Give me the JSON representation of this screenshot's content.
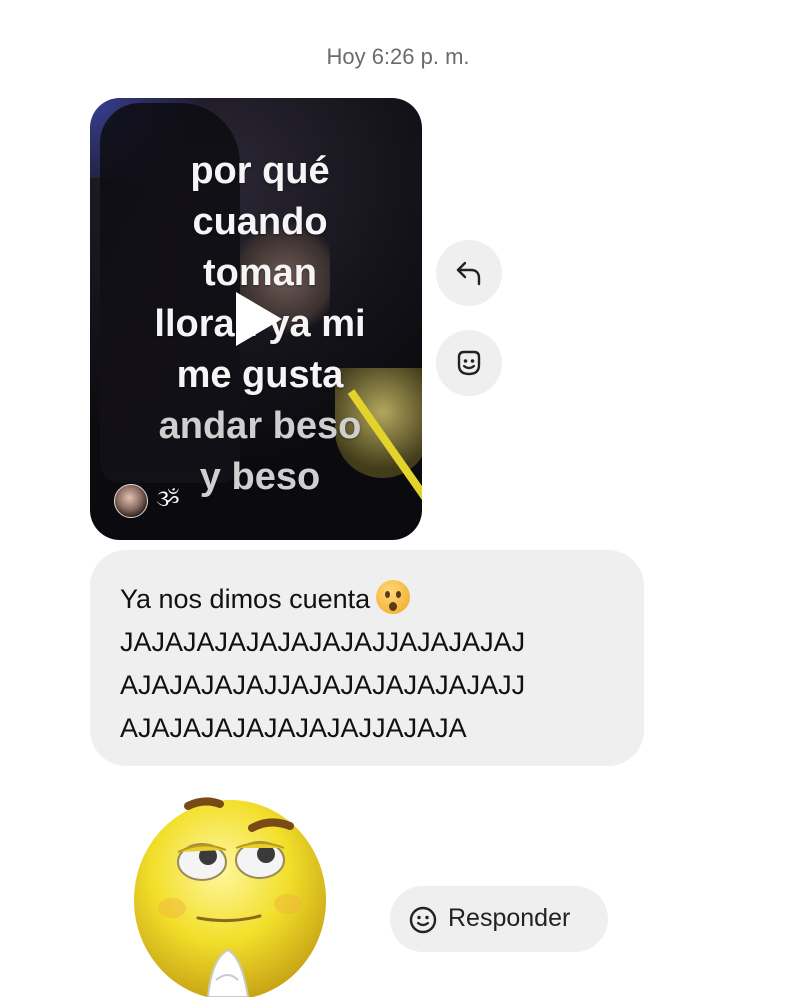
{
  "timestamp": "Hoy 6:26 p. m.",
  "video": {
    "caption_lines": [
      "por qué",
      "cuando",
      "toman",
      "lloran ya mi",
      "me gusta",
      "andar beso",
      "y beso"
    ],
    "creator_name": "ૐ",
    "play_icon": "play-icon"
  },
  "actions": {
    "reply_icon": "reply-arrow-icon",
    "react_icon": "smile-react-icon"
  },
  "message": {
    "lines": [
      "Ya nos dimos cuenta",
      "JAJAJAJAJAJAJAJAJJAJAJAJAJ",
      "AJAJAJAJAJJAJAJAJAJAJAJAJJ",
      "AJAJAJAJAJAJAJAJJAJAJA"
    ],
    "emoji": "😧"
  },
  "sticker": {
    "icon": "praying-smiley-sticker"
  },
  "responder": {
    "label": "Responder",
    "icon": "smile-icon"
  },
  "colors": {
    "bubble": "#efefef",
    "timestamp": "#6b6b6b",
    "straw": "#e3d32b"
  }
}
